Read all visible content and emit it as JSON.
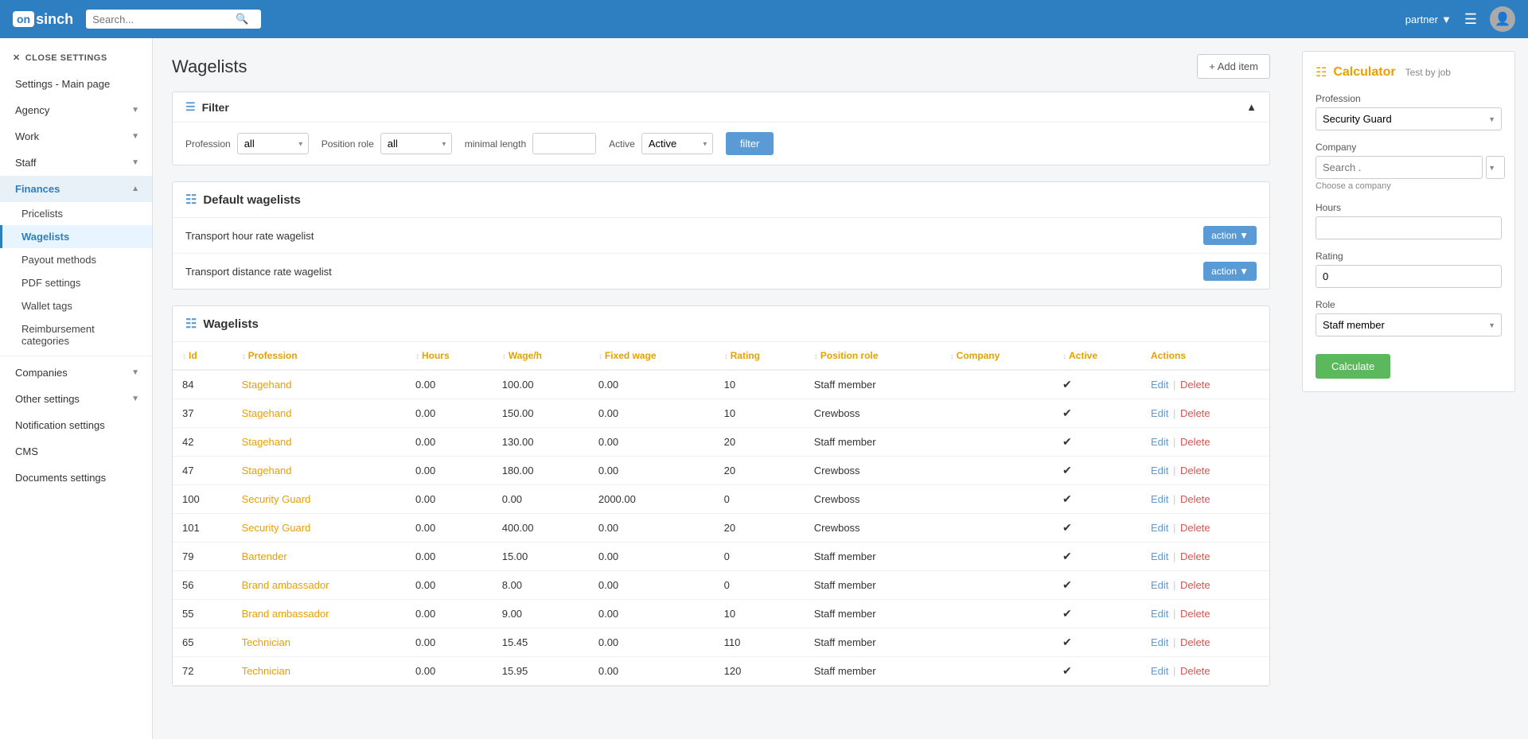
{
  "app": {
    "logo_on": "on",
    "logo_sinch": "sinch",
    "search_placeholder": "Search...",
    "partner_label": "partner",
    "page_title": "Wagelists",
    "add_item_label": "+ Add item"
  },
  "sidebar": {
    "close_label": "CLOSE SETTINGS",
    "items": [
      {
        "id": "settings-main",
        "label": "Settings - Main page",
        "active": false
      },
      {
        "id": "agency",
        "label": "Agency",
        "hasChevron": true
      },
      {
        "id": "work",
        "label": "Work",
        "hasChevron": true
      },
      {
        "id": "staff",
        "label": "Staff",
        "hasChevron": true
      },
      {
        "id": "finances",
        "label": "Finances",
        "hasChevron": true,
        "expanded": true
      },
      {
        "id": "pricelists",
        "label": "Pricelists",
        "sub": true
      },
      {
        "id": "wagelists",
        "label": "Wagelists",
        "sub": true,
        "active": true
      },
      {
        "id": "payout-methods",
        "label": "Payout methods",
        "sub": true
      },
      {
        "id": "pdf-settings",
        "label": "PDF settings",
        "sub": true
      },
      {
        "id": "wallet-tags",
        "label": "Wallet tags",
        "sub": true
      },
      {
        "id": "reimbursement",
        "label": "Reimbursement categories",
        "sub": true
      },
      {
        "id": "companies",
        "label": "Companies",
        "hasChevron": true
      },
      {
        "id": "other-settings",
        "label": "Other settings",
        "hasChevron": true
      },
      {
        "id": "notification-settings",
        "label": "Notification settings"
      },
      {
        "id": "cms",
        "label": "CMS"
      },
      {
        "id": "documents-settings",
        "label": "Documents settings"
      }
    ]
  },
  "filter": {
    "title": "Filter",
    "profession_label": "Profession",
    "profession_value": "all",
    "position_role_label": "Position role",
    "position_role_value": "all",
    "minimal_length_label": "minimal length",
    "active_label": "Active",
    "active_value": "Active",
    "filter_btn": "filter"
  },
  "default_wagelists": {
    "title": "Default wagelists",
    "rows": [
      {
        "name": "Transport hour rate wagelist",
        "action": "action"
      },
      {
        "name": "Transport distance rate wagelist",
        "action": "action"
      }
    ]
  },
  "wagelists_table": {
    "title": "Wagelists",
    "columns": [
      "Id",
      "Profession",
      "Hours",
      "Wage/h",
      "Fixed wage",
      "Rating",
      "Position role",
      "Company",
      "Active",
      "Actions"
    ],
    "rows": [
      {
        "id": "84",
        "profession": "Stagehand",
        "hours": "0.00",
        "wage_h": "100.00",
        "fixed_wage": "0.00",
        "rating": "10",
        "position_role": "Staff member",
        "company": "",
        "active": true
      },
      {
        "id": "37",
        "profession": "Stagehand",
        "hours": "0.00",
        "wage_h": "150.00",
        "fixed_wage": "0.00",
        "rating": "10",
        "position_role": "Crewboss",
        "company": "",
        "active": true
      },
      {
        "id": "42",
        "profession": "Stagehand",
        "hours": "0.00",
        "wage_h": "130.00",
        "fixed_wage": "0.00",
        "rating": "20",
        "position_role": "Staff member",
        "company": "",
        "active": true
      },
      {
        "id": "47",
        "profession": "Stagehand",
        "hours": "0.00",
        "wage_h": "180.00",
        "fixed_wage": "0.00",
        "rating": "20",
        "position_role": "Crewboss",
        "company": "",
        "active": true
      },
      {
        "id": "100",
        "profession": "Security Guard",
        "hours": "0.00",
        "wage_h": "0.00",
        "fixed_wage": "2000.00",
        "rating": "0",
        "position_role": "Crewboss",
        "company": "",
        "active": true
      },
      {
        "id": "101",
        "profession": "Security Guard",
        "hours": "0.00",
        "wage_h": "400.00",
        "fixed_wage": "0.00",
        "rating": "20",
        "position_role": "Crewboss",
        "company": "",
        "active": true
      },
      {
        "id": "79",
        "profession": "Bartender",
        "hours": "0.00",
        "wage_h": "15.00",
        "fixed_wage": "0.00",
        "rating": "0",
        "position_role": "Staff member",
        "company": "",
        "active": true
      },
      {
        "id": "56",
        "profession": "Brand ambassador",
        "hours": "0.00",
        "wage_h": "8.00",
        "fixed_wage": "0.00",
        "rating": "0",
        "position_role": "Staff member",
        "company": "",
        "active": true
      },
      {
        "id": "55",
        "profession": "Brand ambassador",
        "hours": "0.00",
        "wage_h": "9.00",
        "fixed_wage": "0.00",
        "rating": "10",
        "position_role": "Staff member",
        "company": "",
        "active": true
      },
      {
        "id": "65",
        "profession": "Technician",
        "hours": "0.00",
        "wage_h": "15.45",
        "fixed_wage": "0.00",
        "rating": "110",
        "position_role": "Staff member",
        "company": "",
        "active": true
      },
      {
        "id": "72",
        "profession": "Technician",
        "hours": "0.00",
        "wage_h": "15.95",
        "fixed_wage": "0.00",
        "rating": "120",
        "position_role": "Staff member",
        "company": "",
        "active": true
      }
    ]
  },
  "calculator": {
    "title": "Calculator",
    "subtitle": "Test by job",
    "profession_label": "Profession",
    "profession_value": "Security Guard",
    "company_label": "Company",
    "company_search_placeholder": "Search .",
    "company_hint": "Choose a company",
    "hours_label": "Hours",
    "rating_label": "Rating",
    "rating_value": "0",
    "role_label": "Role",
    "role_value": "Staff member",
    "calculate_btn": "Calculate"
  },
  "colors": {
    "brand_blue": "#2d7fc1",
    "accent_orange": "#e8a000",
    "accent_green": "#5cb85c",
    "link_blue": "#5b9bd5",
    "danger_red": "#d9534f"
  }
}
